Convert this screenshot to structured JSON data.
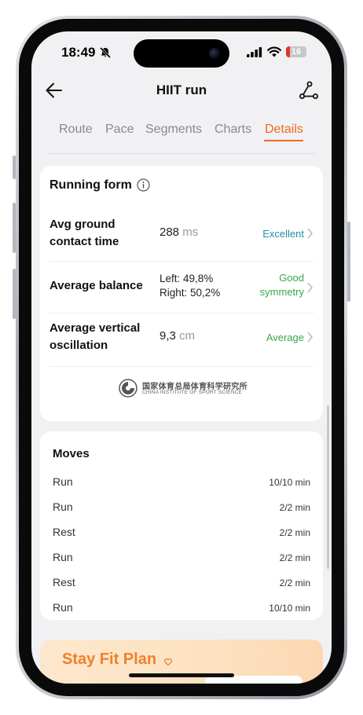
{
  "status_bar": {
    "time": "18:49",
    "battery": "16"
  },
  "header": {
    "title": "HIIT run"
  },
  "tabs": [
    {
      "label": "Route"
    },
    {
      "label": "Pace"
    },
    {
      "label": "Segments"
    },
    {
      "label": "Charts"
    },
    {
      "label": "Details",
      "active": true
    }
  ],
  "running_form": {
    "title": "Running form",
    "metrics": [
      {
        "label_line1": "Avg ground",
        "label_line2": "contact time",
        "value": "288",
        "unit": "ms",
        "rating": "Excellent",
        "rating_color": "#1f8fa6"
      },
      {
        "label_line1": "Average balance",
        "value_line1": "Left: 49,8%",
        "value_line2": "Right: 50,2%",
        "rating_line1": "Good",
        "rating_line2": "symmetry",
        "rating_color": "#3aa64a"
      },
      {
        "label_line1": "Average vertical",
        "label_line2": "oscillation",
        "value": "9,3",
        "unit": "cm",
        "rating": "Average",
        "rating_color": "#3aa64a"
      }
    ],
    "logo": {
      "cn": "国家体育总局体育科学研究所",
      "en": "CHINA INSTITUTE OF SPORT SCIENCE"
    }
  },
  "moves": {
    "title": "Moves",
    "items": [
      {
        "name": "Run",
        "duration": "10/10 min"
      },
      {
        "name": "Run",
        "duration": "2/2 min"
      },
      {
        "name": "Rest",
        "duration": "2/2 min"
      },
      {
        "name": "Run",
        "duration": "2/2 min"
      },
      {
        "name": "Rest",
        "duration": "2/2 min"
      },
      {
        "name": "Run",
        "duration": "10/10 min"
      }
    ]
  },
  "promo": {
    "title": "Stay Fit Plan"
  },
  "colors": {
    "accent": "#f06a22",
    "excellent": "#1f8fa6",
    "good": "#3aa64a"
  }
}
